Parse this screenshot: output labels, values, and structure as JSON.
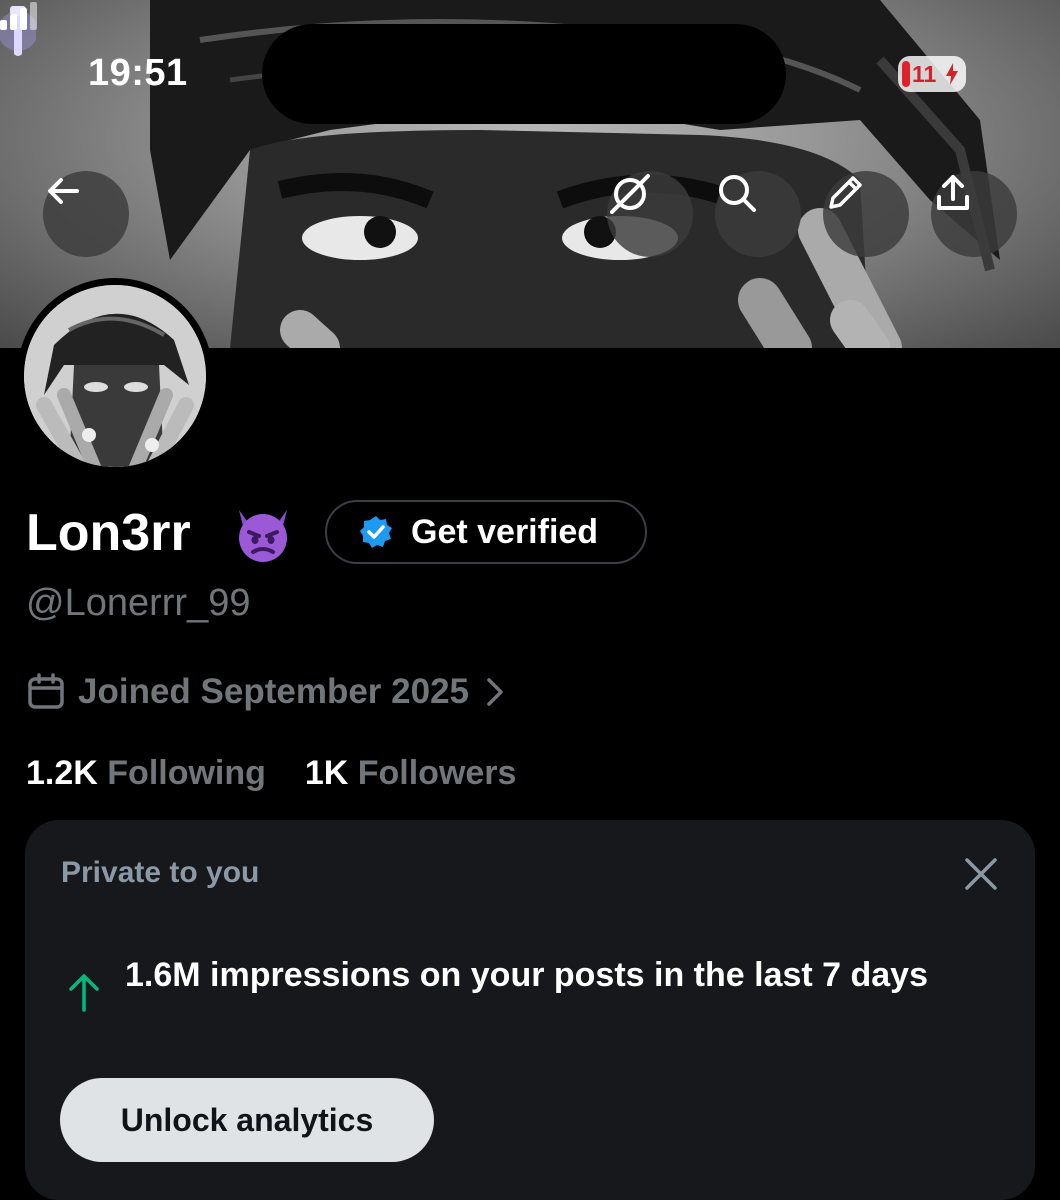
{
  "status_bar": {
    "time": "19:51",
    "battery_level": "11",
    "icons": [
      "flashlight-icon",
      "signal-icon",
      "battery-charging-icon"
    ]
  },
  "top_actions": {
    "icons": [
      "back-arrow-icon",
      "grok-icon",
      "search-icon",
      "edit-pencil-icon",
      "share-icon"
    ]
  },
  "profile": {
    "display_name": "Lon3rr",
    "name_emoji": "smiling-imp-emoji",
    "verify_label": "Get verified",
    "handle": "@Lonerrr_99",
    "joined": "Joined September 2025",
    "following_count": "1.2K",
    "following_label": "Following",
    "followers_count": "1K",
    "followers_label": "Followers"
  },
  "analytics_card": {
    "header": "Private to you",
    "impressions_text": "1.6M impressions on your posts in the last 7 days",
    "button_label": "Unlock analytics"
  },
  "colors": {
    "background": "#000000",
    "muted_text": "#71767b",
    "card_bg": "#16181c",
    "verified_blue": "#1d9bf0",
    "up_arrow_green": "#00ba7c",
    "button_bg": "#dfe3e6"
  }
}
